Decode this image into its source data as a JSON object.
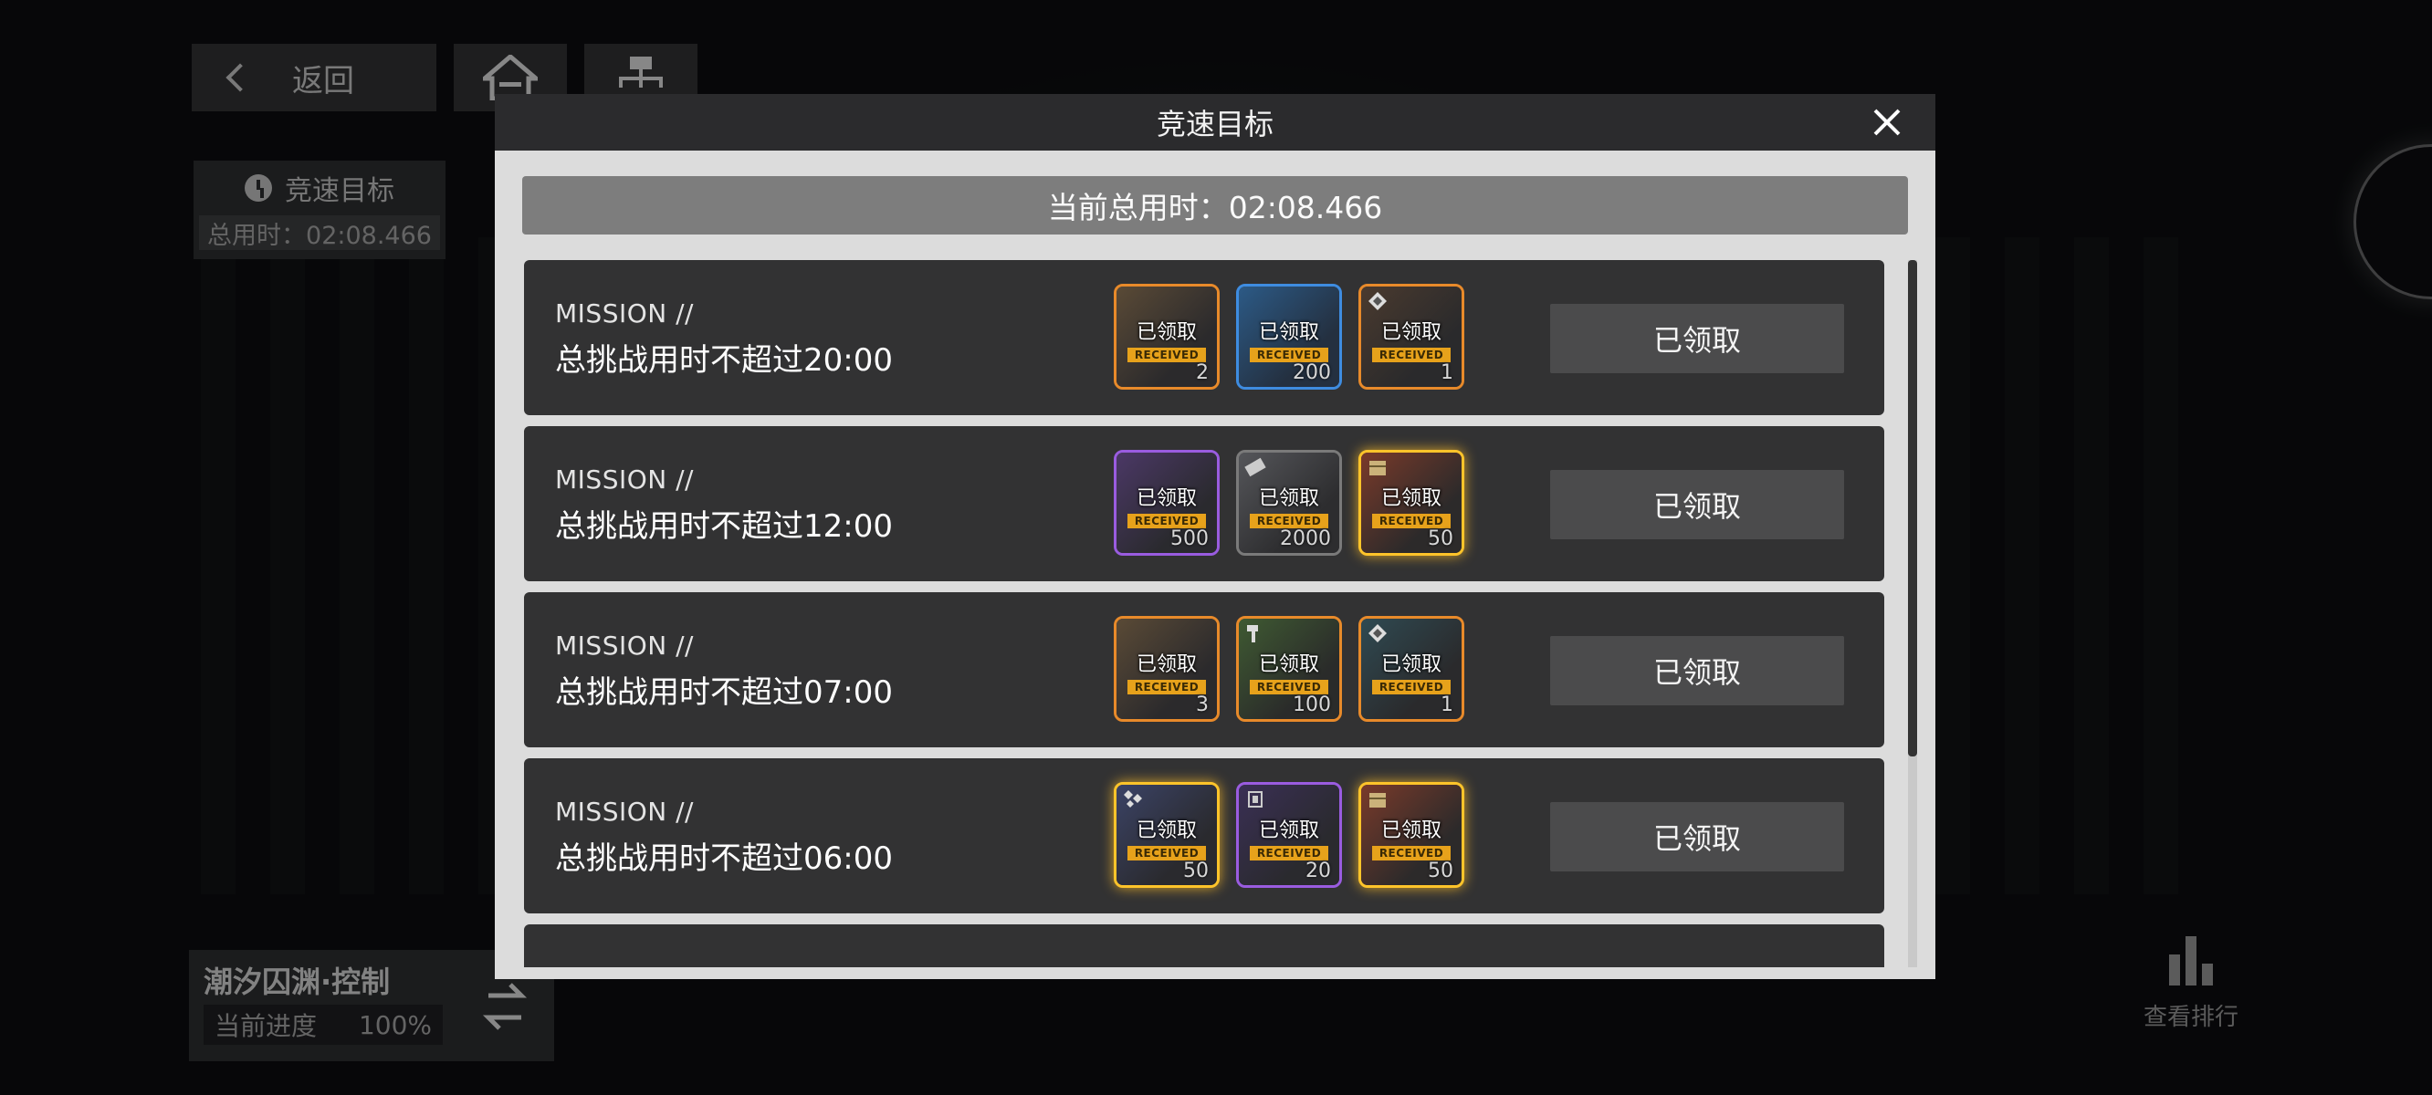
{
  "background": {
    "nav": {
      "back_label": "返回"
    },
    "race_panel": {
      "title": "竞速目标",
      "total_time": "总用时：02:08.466"
    },
    "progress_panel": {
      "title": "潮汐囚渊·控制",
      "progress_label": "当前进度",
      "progress_value": "100%"
    },
    "rank_label": "查看排行"
  },
  "dialog": {
    "title": "竞速目标",
    "total_time": "当前总用时：02:08.466",
    "missions": [
      {
        "label": "MISSION //",
        "title": "总挑战用时不超过20:00",
        "button": "已领取",
        "rewards": [
          {
            "frame": "orange",
            "received": "已领取",
            "received_en": "RECEIVED",
            "qty": "2"
          },
          {
            "frame": "blue",
            "received": "已领取",
            "received_en": "RECEIVED",
            "qty": "200"
          },
          {
            "frame": "orange",
            "received": "已领取",
            "received_en": "RECEIVED",
            "qty": "1"
          }
        ]
      },
      {
        "label": "MISSION //",
        "title": "总挑战用时不超过12:00",
        "button": "已领取",
        "rewards": [
          {
            "frame": "purple",
            "received": "已领取",
            "received_en": "RECEIVED",
            "qty": "500"
          },
          {
            "frame": "gray",
            "received": "已领取",
            "received_en": "RECEIVED",
            "qty": "2000"
          },
          {
            "frame": "gold",
            "received": "已领取",
            "received_en": "RECEIVED",
            "qty": "50"
          }
        ]
      },
      {
        "label": "MISSION //",
        "title": "总挑战用时不超过07:00",
        "button": "已领取",
        "rewards": [
          {
            "frame": "orange",
            "received": "已领取",
            "received_en": "RECEIVED",
            "qty": "3"
          },
          {
            "frame": "orange",
            "received": "已领取",
            "received_en": "RECEIVED",
            "qty": "100"
          },
          {
            "frame": "orange",
            "received": "已领取",
            "received_en": "RECEIVED",
            "qty": "1"
          }
        ]
      },
      {
        "label": "MISSION //",
        "title": "总挑战用时不超过06:00",
        "button": "已领取",
        "rewards": [
          {
            "frame": "gold",
            "received": "已领取",
            "received_en": "RECEIVED",
            "qty": "50"
          },
          {
            "frame": "purple",
            "received": "已领取",
            "received_en": "RECEIVED",
            "qty": "20"
          },
          {
            "frame": "gold",
            "received": "已领取",
            "received_en": "RECEIVED",
            "qty": "50"
          }
        ]
      }
    ]
  },
  "colors": {
    "orange_frame": "#e88a2a",
    "blue_frame": "#3e8ce0",
    "purple_frame": "#9a5ce0",
    "gold_frame": "#ffc42a",
    "received_tag": "#e7a21b"
  }
}
